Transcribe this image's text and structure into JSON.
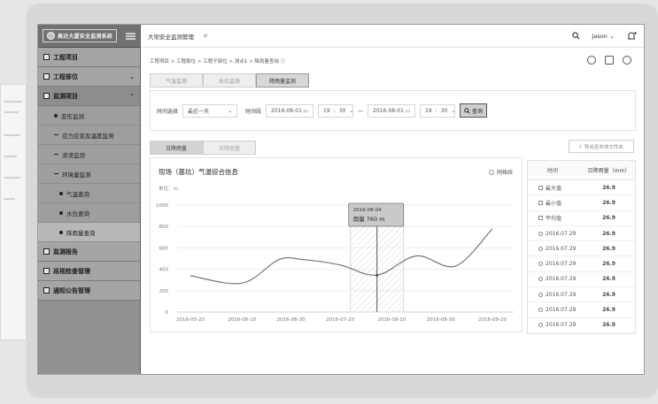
{
  "app": {
    "logo_text": "高达大厦安全监测系统",
    "tab_title": "大坝安全监测管理",
    "user": "Jason"
  },
  "sidebar": {
    "items": [
      {
        "label": "工程项目",
        "kind": "top"
      },
      {
        "label": "工程部位",
        "kind": "top"
      },
      {
        "label": "监测项目",
        "kind": "top"
      },
      {
        "label": "变形监测",
        "kind": "sub"
      },
      {
        "label": "应力应变及温度监测",
        "kind": "sub"
      },
      {
        "label": "渗流监测",
        "kind": "sub"
      },
      {
        "label": "环境量监测",
        "kind": "sub"
      },
      {
        "label": "气温查询",
        "kind": "subsub"
      },
      {
        "label": "水位查询",
        "kind": "subsub"
      },
      {
        "label": "降雨量查询",
        "kind": "subsub"
      },
      {
        "label": "监测报告",
        "kind": "top"
      },
      {
        "label": "巡视检查管理",
        "kind": "top"
      },
      {
        "label": "通知公告管理",
        "kind": "top"
      }
    ]
  },
  "breadcrumb": "工程项目 > 工程部位 > 工程子部位 > 测点1 > 降雨量查询",
  "mode_tabs": [
    "气温监测",
    "水位监测",
    "降雨量监测"
  ],
  "filter": {
    "time_select_label": "时间选择",
    "time_select_value": "最近一天",
    "period_label": "时间段",
    "start_date": "2016-08-01",
    "start_hour": "19",
    "start_min": "30",
    "range_sep": "—",
    "end_date": "2016-08-01",
    "end_hour": "19",
    "end_min": "30",
    "search_button": "查询"
  },
  "chart_tabs": [
    "日降雨量",
    "月降雨量"
  ],
  "export_button": "导出至本地文件夹",
  "chart": {
    "title": "现场（基坑）气温综合信息",
    "legend": "网格线",
    "unit": "单位：m",
    "tooltip_date": "2016-08-04",
    "tooltip_value": "雨量 760 m"
  },
  "chart_data": {
    "type": "line",
    "ylim": [
      0,
      1000
    ],
    "yticks": [
      0,
      200,
      400,
      600,
      800,
      1000
    ],
    "xticks": [
      "2016-05-20",
      "2016-06-10",
      "2016-06-30",
      "2016-07-20",
      "2016-08-10",
      "2016-08-30",
      "2016-09-20"
    ],
    "x": [
      "2016-05-20",
      "2016-06-10",
      "2016-06-25",
      "2016-07-05",
      "2016-07-20",
      "2016-08-04",
      "2016-08-20",
      "2016-09-05",
      "2016-09-20"
    ],
    "values": [
      340,
      270,
      490,
      490,
      440,
      345,
      525,
      430,
      780
    ]
  },
  "table": {
    "headers": [
      "时间",
      "日降雨量（mm）"
    ],
    "rows": [
      {
        "label": "最大值",
        "value": "26.9",
        "icon": "square"
      },
      {
        "label": "最小值",
        "value": "26.9",
        "icon": "square"
      },
      {
        "label": "平均值",
        "value": "26.9",
        "icon": "square"
      },
      {
        "label": "2016.07.29",
        "value": "26.9",
        "icon": "clock"
      },
      {
        "label": "2016.07.29",
        "value": "26.9",
        "icon": "clock"
      },
      {
        "label": "2016.07.29",
        "value": "26.9",
        "icon": "clock"
      },
      {
        "label": "2016.07.29",
        "value": "26.9",
        "icon": "clock"
      },
      {
        "label": "2016.07.29",
        "value": "26.9",
        "icon": "clock"
      },
      {
        "label": "2016.07.29",
        "value": "26.9",
        "icon": "clock"
      },
      {
        "label": "2016.07.29",
        "value": "26.9",
        "icon": "clock"
      }
    ]
  }
}
